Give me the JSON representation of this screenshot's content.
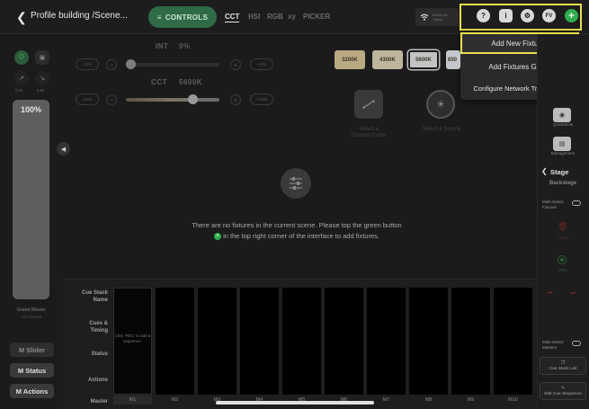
{
  "header": {
    "title": "Profile building /Scene...",
    "controls_label": "CONTROLS",
    "mode_tabs": [
      "CCT",
      "HSI",
      "RGB",
      "xy",
      "PICKER"
    ],
    "active_tab": "CCT",
    "wifi_box": {
      "line1": "Bluetooth",
      "line2": "Signal"
    },
    "toolbar": {
      "help": "?",
      "info": "i",
      "settings": "⚙",
      "fv": "FV",
      "add": "+"
    },
    "highlight_color": "#e8e04a",
    "add_color": "#2fae4e"
  },
  "menu": {
    "items": [
      "Add New Fixtures",
      "Add Fixtures Group",
      "Configure Network Transceiver"
    ]
  },
  "left": {
    "btn_a1_caption": "0.5s",
    "btn_a2_caption": "0.5s",
    "master_percent": "100%",
    "master_level": 1.0,
    "grand_master_label": "Grand Master",
    "all_fixtures_label": "All Fixtures",
    "buttons": [
      "M Slider",
      "M Status",
      "M Actions"
    ]
  },
  "sliders": {
    "int": {
      "label": "INT",
      "value": "0%",
      "minus": "-10%",
      "plus": "+10%",
      "level": 0.0
    },
    "cct": {
      "label": "CCT",
      "value": "5600K",
      "minus": "-100K",
      "plus": "+100K",
      "level": 0.74
    }
  },
  "presets": [
    "3200K",
    "4300K",
    "5600K",
    "650"
  ],
  "selected_preset": "5600K",
  "select_tiles": [
    {
      "caption": "Select a\nDimmer Curve"
    },
    {
      "caption": "Select a Source"
    }
  ],
  "empty_notice": {
    "line1": "There are no fixtures in the current scene. Please top the green button",
    "line2": "in the top right corner of the interface to add fixtures."
  },
  "cue_stack": {
    "row_labels": [
      "Cue Stack\nName",
      "Cues &\nTiming",
      "Status",
      "Actions",
      "Master"
    ],
    "columns": [
      "M1",
      "M2",
      "M3",
      "M4",
      "M5",
      "M6",
      "M7",
      "M8",
      "M9",
      "M10"
    ],
    "m1_hint": "Click 'REC' to add a sequence."
  },
  "right": {
    "quickshots": "Quickshots",
    "management": "Management",
    "stage": "Stage",
    "backstage": "Backstage",
    "multi_select_fixtures": "Multi-Select\nFixtures",
    "open": "Open",
    "rec": "REC",
    "multi_select_masters": "Multi-Select\nMasters",
    "cue_stack_list": "Cue Stack List",
    "edit_cue_sequence": "Edit Cue Sequence"
  }
}
